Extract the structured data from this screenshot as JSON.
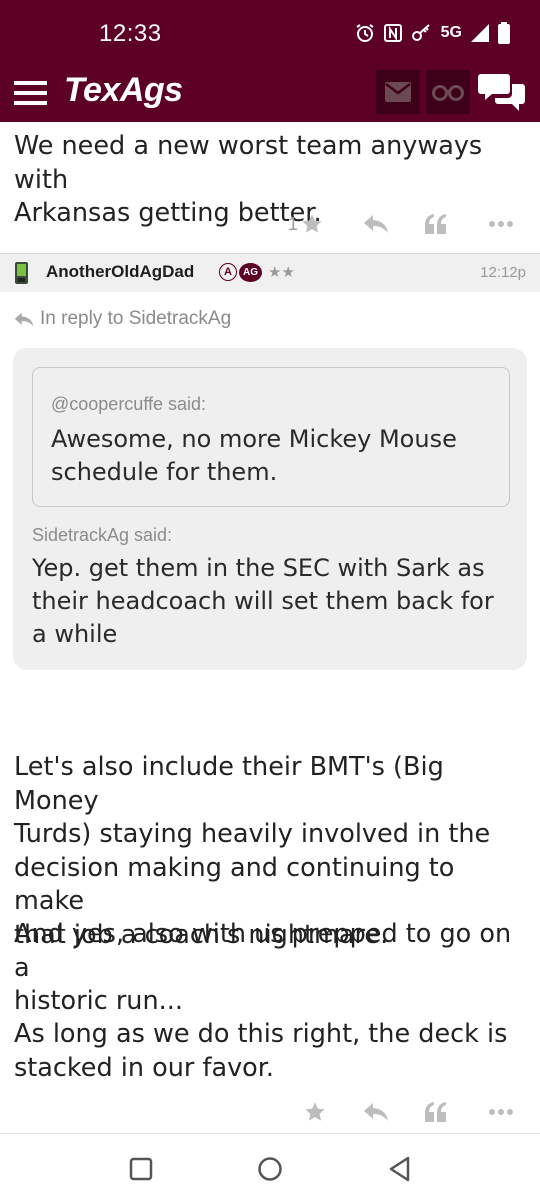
{
  "status_bar": {
    "time": "12:33",
    "network": "5G"
  },
  "app": {
    "logo_text": "TexAgs"
  },
  "previous_post": {
    "text_lines": [
      "We need a new worst team anyways with",
      "Arkansas getting better."
    ],
    "star_count": "1"
  },
  "post": {
    "author": "AnotherOldAgDad",
    "badge_a": "A",
    "badge_ag": "AG",
    "rating": "★★",
    "time": "12:12p",
    "reply_to": "In reply to SidetrackAg",
    "inner_quote": {
      "said": "@coopercuffe said:",
      "lines": [
        "Awesome, no more Mickey Mouse",
        "schedule for them."
      ]
    },
    "outer_quote": {
      "said": "SidetrackAg said:",
      "lines": [
        "Yep. get them in the SEC with Sark as",
        "their headcoach will set them back for",
        "a while"
      ]
    },
    "body": {
      "p1": [
        "Let's also include their BMT's (Big Money",
        "Turds) staying heavily involved in the",
        "decision making and continuing to make",
        "that job a coach's nightmare."
      ],
      "p2": [
        "And yes, also with us prepped to go on a",
        "historic run..."
      ],
      "p3": [
        "As long as we do this right, the deck is",
        "stacked in our favor."
      ]
    }
  },
  "colors": {
    "brand": "#5c0025",
    "header_button": "#3d0018"
  },
  "icons": [
    "alarm-icon",
    "nfc-icon",
    "key-icon",
    "signal-icon",
    "battery-icon",
    "menu-icon",
    "mail-icon",
    "binoculars-icon",
    "chat-icon",
    "star-icon",
    "reply-icon",
    "quote-icon",
    "more-icon",
    "phone-icon",
    "recents-icon",
    "home-icon",
    "back-icon"
  ]
}
